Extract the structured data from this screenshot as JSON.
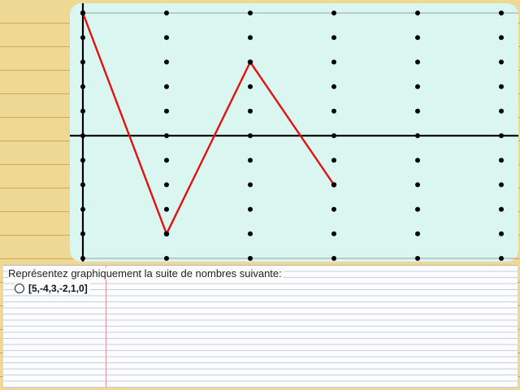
{
  "question": {
    "prompt": "Représentez graphiquement la suite de nombres suivante:",
    "options": [
      {
        "label": "[5,-4,3,-2,1,0]",
        "selected": false
      }
    ]
  },
  "chart_data": {
    "type": "line",
    "x": [
      0,
      1,
      2,
      3
    ],
    "values": [
      5,
      -4,
      3,
      -2
    ],
    "grid_columns": [
      0,
      1,
      2,
      3,
      4,
      5
    ],
    "ylim": [
      -5,
      5
    ],
    "grid": "dots",
    "colors": {
      "line": "#e31010",
      "axes": "#000000",
      "dots": "#000000",
      "background": "#daf6f1"
    }
  }
}
